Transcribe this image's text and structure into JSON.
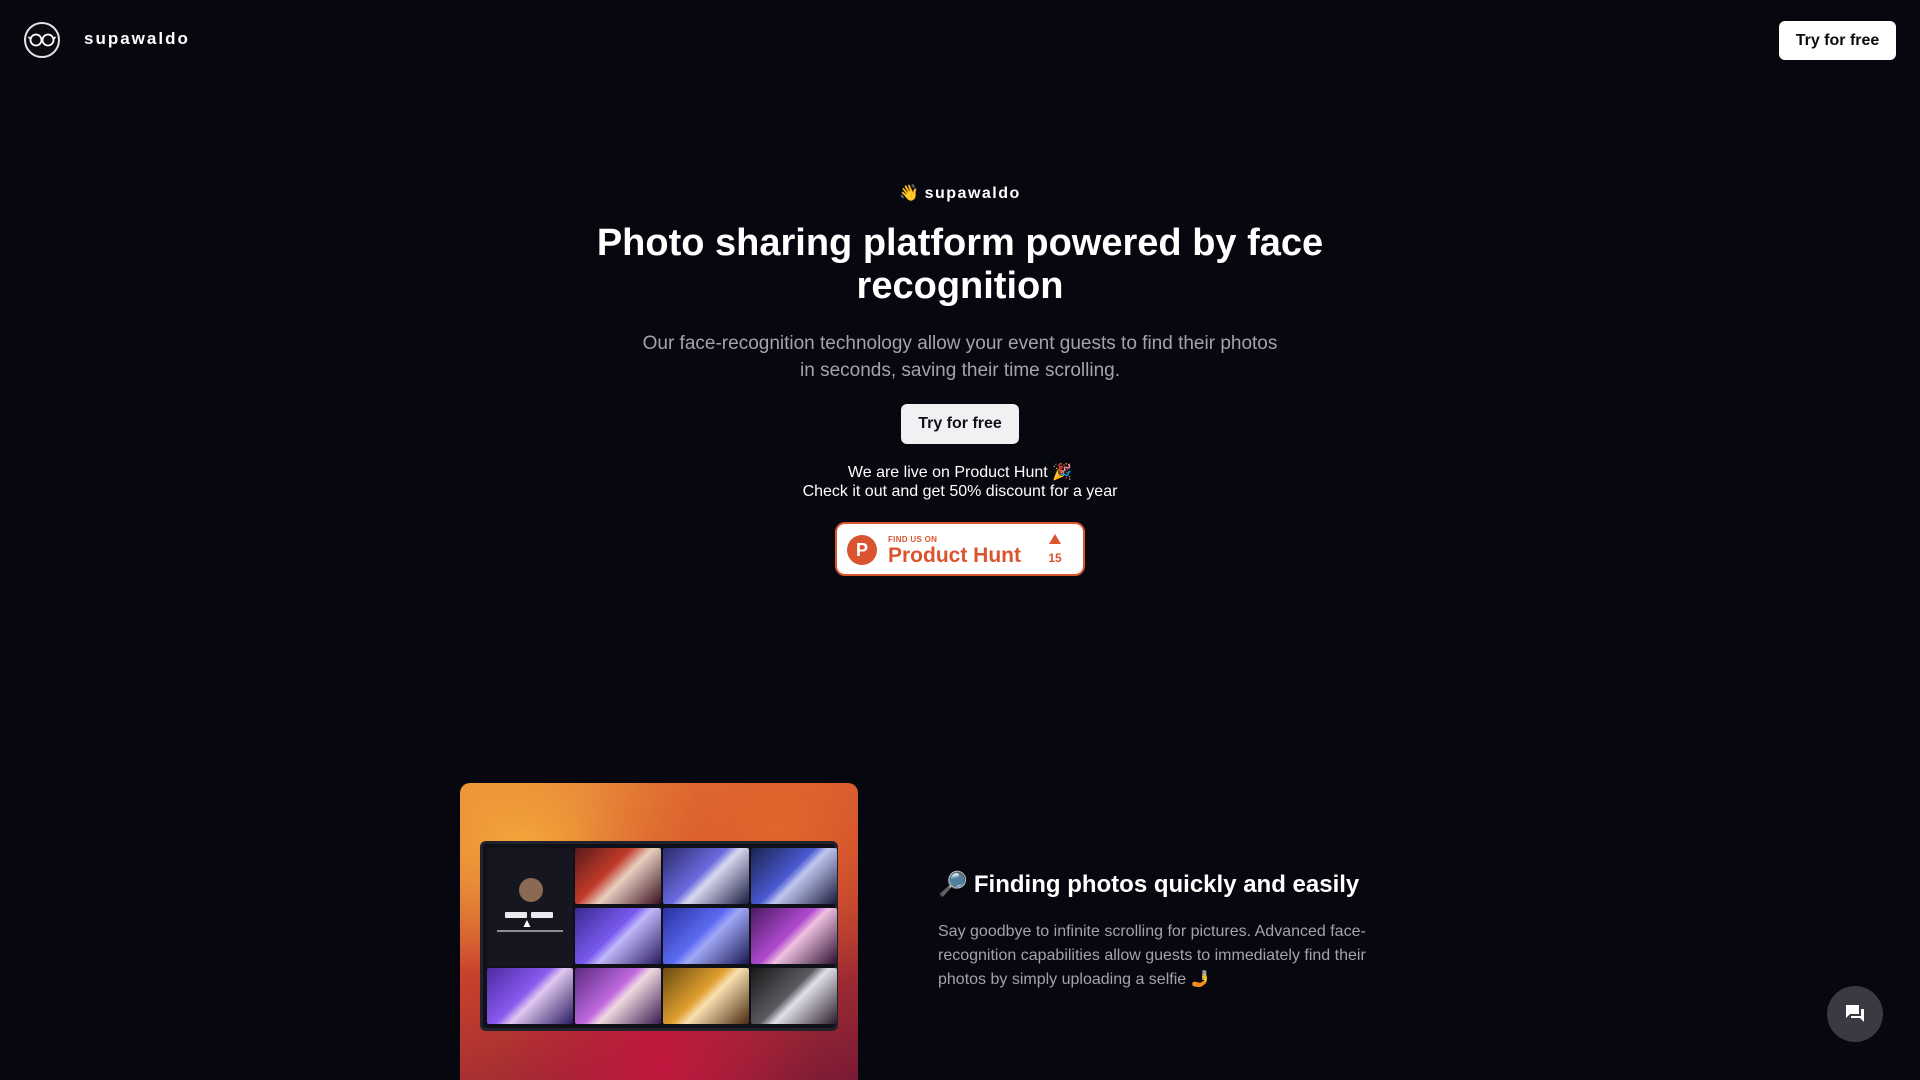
{
  "header": {
    "brand": "supawaldo",
    "cta_label": "Try for free",
    "logo_icon": "glasses-icon"
  },
  "hero": {
    "eyebrow_emoji": "👋",
    "eyebrow_text": "supawaldo",
    "title": "Photo sharing platform powered by face recognition",
    "subtitle": "Our face-recognition technology allow your event guests to find their photos in seconds, saving their time scrolling.",
    "cta_label": "Try for free"
  },
  "product_hunt": {
    "note_line1": "We are live on Product Hunt 🎉",
    "note_line2": "Check it out and get 50% discount for a year",
    "badge_small": "FIND US ON",
    "badge_name": "Product Hunt",
    "badge_letter": "P",
    "upvotes": "15",
    "brand_color": "#da552f"
  },
  "feature": {
    "icon": "🔎",
    "title": "Finding photos quickly and easily",
    "text": "Say goodbye to infinite scrolling for pictures. Advanced face-recognition capabilities allow guests to immediately find their photos by simply uploading a selfie 🤳"
  },
  "chat": {
    "icon": "chat-icon"
  },
  "colors": {
    "background": "#07070f",
    "muted_text": "#a3a3b0",
    "button_bg": "#ffffff"
  }
}
